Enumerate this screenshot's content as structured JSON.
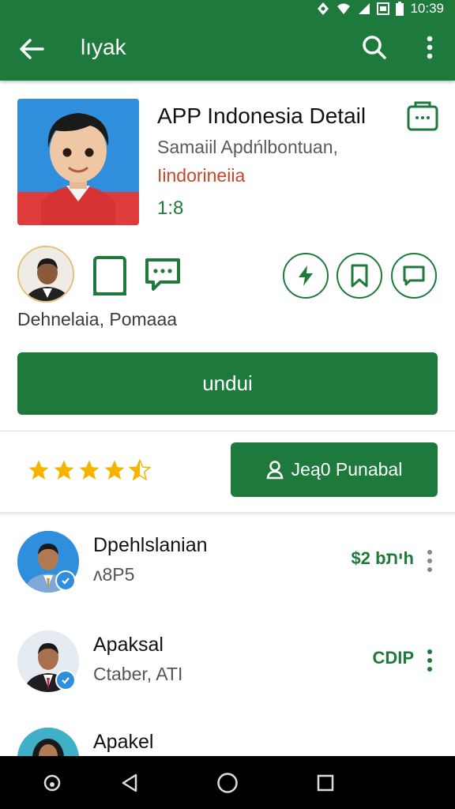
{
  "status": {
    "time": "10:39"
  },
  "appbar": {
    "title": "lıyak"
  },
  "app": {
    "title": "APP Indonesia Detail",
    "subtitle": "Samaiil Apdńlbontuan,",
    "developer": "Iindorineiia",
    "version": "1:8"
  },
  "dev_row": {
    "name": "Dehnelaia, Pomaaa"
  },
  "install": {
    "label": "undui"
  },
  "rating": {
    "value": 4.5,
    "max": 5
  },
  "secondary_button": {
    "label": "Jeą0 Punabal"
  },
  "list": {
    "items": [
      {
        "title": "Dpehlslanian",
        "subtitle": "ʌ8P5",
        "price": "$2 bיתh"
      },
      {
        "title": "Apaksal",
        "subtitle": "Ctaber, ATI",
        "price": "CDIP"
      },
      {
        "title": "Apakel",
        "subtitle": "",
        "price": ""
      }
    ]
  },
  "colors": {
    "primary": "#1e7a3c",
    "accent_text": "#c0492a",
    "star": "#f4b400"
  }
}
